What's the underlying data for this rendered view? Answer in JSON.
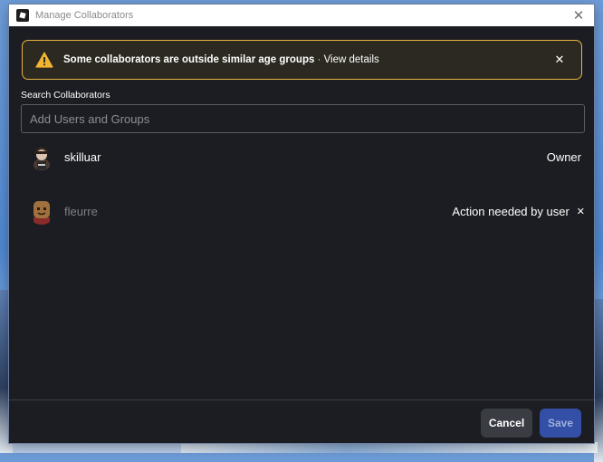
{
  "window": {
    "title": "Manage Collaborators"
  },
  "banner": {
    "message": "Some collaborators are outside similar age groups",
    "separator": " · ",
    "link_text": "View details",
    "border_color": "#e7b33f"
  },
  "search": {
    "label": "Search Collaborators",
    "placeholder": "Add Users and Groups",
    "value": ""
  },
  "collaborators": [
    {
      "name": "skilluar",
      "role": "Owner",
      "avatar": "user-avatar",
      "status": "active"
    },
    {
      "name": "fleurre",
      "role": "Action needed by user",
      "avatar": "default-avatar",
      "status": "pending"
    }
  ],
  "footer": {
    "cancel_label": "Cancel",
    "save_label": "Save"
  },
  "colors": {
    "dialog_bg": "#1c1d22",
    "accent_blue": "#334fa6",
    "warning": "#e7b33f"
  }
}
